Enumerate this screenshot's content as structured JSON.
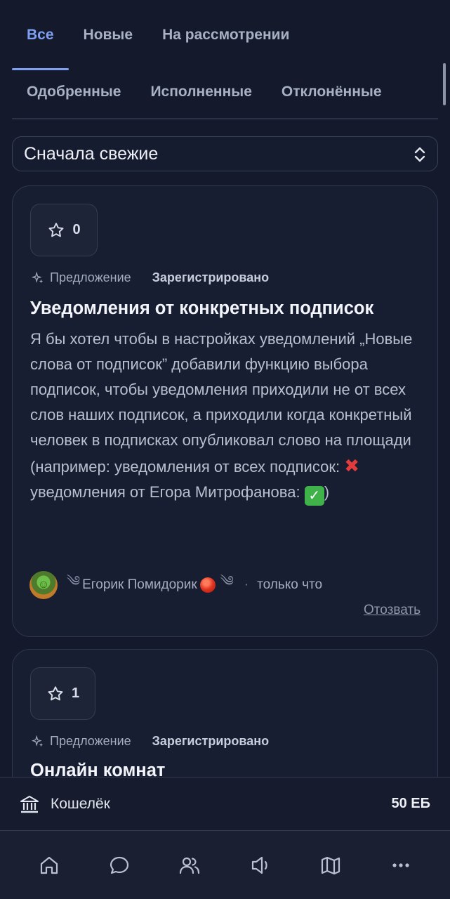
{
  "tabs": {
    "row1": [
      "Все",
      "Новые",
      "На рассмотрении"
    ],
    "row2": [
      "Одобренные",
      "Исполненные",
      "Отклонённые"
    ],
    "active": "Все"
  },
  "sort": {
    "label": "Сначала свежие"
  },
  "cards": [
    {
      "votes": "0",
      "type": "Предложение",
      "status": "Зарегистрировано",
      "title": "Уведомления от конкретных подписок",
      "body_part1": "Я бы хотел чтобы в настройках уведомлений „Новые слова от подписок” добавили функцию выбора подписок, чтобы уведомления приходили не от всех слов наших подписок, а приходили когда конкретный человек в подписках опубликовал слово на площади (например: уведомления от всех подписок:",
      "body_part2": "уведомления от Егора Митрофанова:",
      "body_end": ")",
      "author": "Егорик Помидорик",
      "time": "только что",
      "revoke": "Отозвать"
    },
    {
      "votes": "1",
      "type": "Предложение",
      "status": "Зарегистрировано",
      "title": "Онлайн комнат"
    }
  ],
  "wallet": {
    "label": "Кошелёк",
    "amount": "50 ЕБ"
  },
  "nav": [
    "home-icon",
    "chat-icon",
    "users-icon",
    "megaphone-icon",
    "map-icon",
    "more-icon"
  ]
}
